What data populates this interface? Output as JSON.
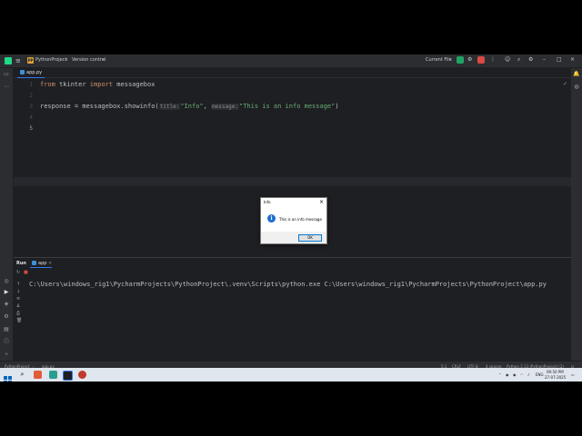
{
  "titlebar": {
    "project_badge": "PP",
    "project_name": "PythonProject",
    "vcs": "Version control",
    "run_config": "Current File",
    "accent": "#21d789"
  },
  "editor": {
    "tab": "app.py",
    "lines": [
      "1",
      "2",
      "3",
      "4",
      "5"
    ],
    "code": {
      "kw_from": "from",
      "module": " tkinter ",
      "kw_import": "import",
      "name": " messagebox",
      "l3_start": "response = messagebox.showinfo(",
      "hint_title": "title:",
      "str_title": "\"Info\"",
      "comma": ", ",
      "hint_message": "message:",
      "str_message": "\"This is an info message\"",
      "close": ")"
    }
  },
  "run_panel": {
    "label": "Run",
    "tab": "app",
    "close": "×",
    "console": "C:\\Users\\windows_rig1\\PycharmProjects\\PythonProject\\.venv\\Scripts\\python.exe C:\\Users\\windows_rig1\\PycharmProjects\\PythonProject\\app.py"
  },
  "statusbar": {
    "breadcrumb_project": "PythonProject",
    "breadcrumb_file": "app.py",
    "position": "5:1",
    "line_sep": "CRLF",
    "encoding": "UTF-8",
    "indent": "4 spaces",
    "interpreter": "Python 3.13 (PythonProject) (2)"
  },
  "dialog": {
    "title": "Info",
    "message": "This is an info message",
    "ok": "OK",
    "close": "×",
    "icon": "i"
  },
  "taskbar": {
    "lang": "ENG",
    "time": "09:50 PM",
    "date": "27-07-2025"
  }
}
